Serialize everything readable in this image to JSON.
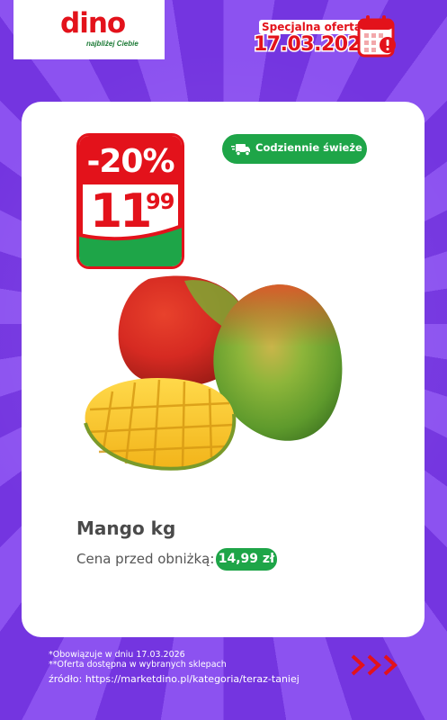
{
  "logo": {
    "brand": "dino",
    "tagline": "najbliżej Ciebie"
  },
  "offer": {
    "label": "Specjalna oferta",
    "date": "17.03.2026",
    "icon": "calendar-alert-icon"
  },
  "price_tag": {
    "discount": "-20%",
    "price_int": "11",
    "price_dec": "99"
  },
  "badge": {
    "text": "Codziennie świeże",
    "icon": "delivery-truck-icon"
  },
  "product": {
    "name": "Mango kg",
    "old_price_label": "Cena przed obniżką:",
    "old_price": "14,99 zł"
  },
  "footer": {
    "note1": "*Obowiązuje w dniu 17.03.2026",
    "note2": "**Oferta dostępna w wybranych sklepach",
    "source": "źródło: https://marketdino.pl/kategoria/teraz-taniej",
    "arrows_icon": "triple-chevron-right-icon"
  },
  "colors": {
    "accent_red": "#e3121b",
    "brand_green": "#1ea548",
    "background_purple": "#7b3fe6"
  }
}
